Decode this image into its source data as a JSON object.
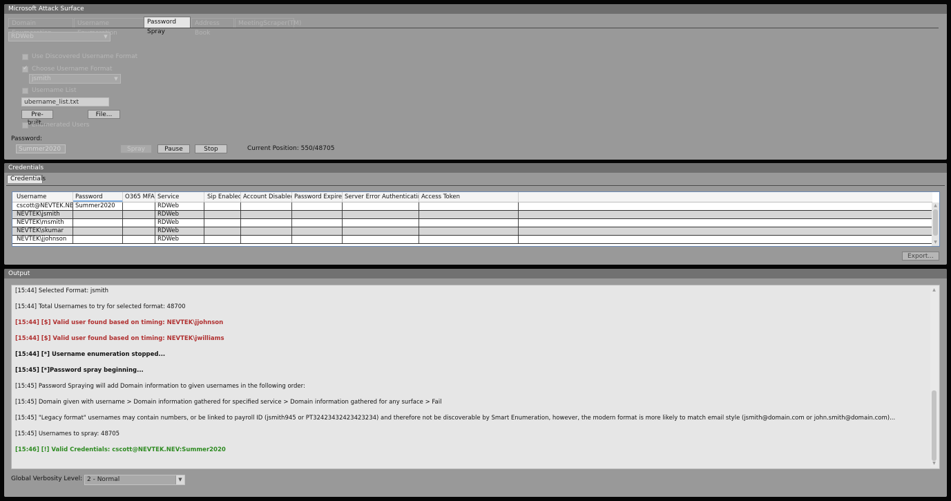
{
  "attack_panel": {
    "title": "Microsoft Attack Surface",
    "tabs": [
      {
        "label": "Domain Enumeration",
        "active": false
      },
      {
        "label": "Username Enumeration",
        "active": false
      },
      {
        "label": "Password Spray",
        "active": true
      },
      {
        "label": "Address Book",
        "active": false
      },
      {
        "label": "MeetingScraper(TM)",
        "active": false
      }
    ],
    "service_select": "RDWeb",
    "use_discovered_label": "Use Discovered Username Format",
    "choose_format_label": "Choose Username Format",
    "format_select": "jsmith",
    "username_list_label": "Username List",
    "username_list_value": "ubername_list.txt",
    "prebuilt_button": "Pre-built...",
    "file_button": "File...",
    "enumerated_users_label": "Enumerated Users",
    "password_label": "Password:",
    "password_value": "Summer2020",
    "spray_button": "Spray",
    "pause_button": "Pause",
    "stop_button": "Stop",
    "current_position": "Current Position: 550/48705"
  },
  "credentials_panel": {
    "title": "Credentials",
    "tab": "Credentials",
    "columns": [
      "Username",
      "Password",
      "O365 MFA",
      "Service",
      "Sip Enabled",
      "Account Disabled",
      "Password Expired",
      "Server Error Authenticating",
      "Access Token"
    ],
    "rows": [
      [
        "cscott@NEVTEK.NEV",
        "Summer2020",
        "",
        "RDWeb",
        "",
        "",
        "",
        "",
        ""
      ],
      [
        "NEVTEK\\jsmith",
        "",
        "",
        "RDWeb",
        "",
        "",
        "",
        "",
        ""
      ],
      [
        "NEVTEK\\msmith",
        "",
        "",
        "RDWeb",
        "",
        "",
        "",
        "",
        ""
      ],
      [
        "NEVTEK\\skumar",
        "",
        "",
        "RDWeb",
        "",
        "",
        "",
        "",
        ""
      ],
      [
        "NEVTEK\\jjohnson",
        "",
        "",
        "RDWeb",
        "",
        "",
        "",
        "",
        ""
      ]
    ],
    "export_button": "Export..."
  },
  "output_panel": {
    "title": "Output",
    "lines": [
      {
        "text": "[15:44] Selected Format: jsmith",
        "style": "normal"
      },
      {
        "text": "[15:44] Total Usernames to try for selected format: 48700",
        "style": "normal"
      },
      {
        "text": "[15:44] [$] Valid user found based on timing: NEVTEK\\jjohnson",
        "style": "red"
      },
      {
        "text": "[15:44] [$] Valid user found based on timing: NEVTEK\\jwilliams",
        "style": "red"
      },
      {
        "text": "[15:44] [*] Username enumeration stopped...",
        "style": "bold"
      },
      {
        "text": "[15:45] [*]Password spray beginning...",
        "style": "bold"
      },
      {
        "text": "[15:45] Password Spraying will add Domain information to given usernames in the following order:",
        "style": "normal"
      },
      {
        "text": "[15:45] Domain given with username > Domain information gathered for specified service > Domain information gathered for any surface > Fail",
        "style": "normal"
      },
      {
        "text": "[15:45] \"Legacy format\" usernames may contain numbers, or be linked to payroll ID (jsmith945 or PT32423432423423234) and therefore not be discoverable by Smart Enumeration, however, the modern format is more likely to match email style (jsmith@domain.com or john.smith@domain.com)...",
        "style": "normal"
      },
      {
        "text": "[15:45]  Usernames to spray: 48705",
        "style": "normal"
      },
      {
        "text": "[15:46] [!] Valid Credentials: cscott@NEVTEK.NEV:Summer2020",
        "style": "green"
      }
    ],
    "verbosity_label": "Global Verbosity Level:",
    "verbosity_value": "2 - Normal"
  },
  "colors": {
    "accent_red": "#b03030",
    "accent_green": "#2e8b22",
    "panel": "#999999",
    "header": "#6e6e6e"
  }
}
